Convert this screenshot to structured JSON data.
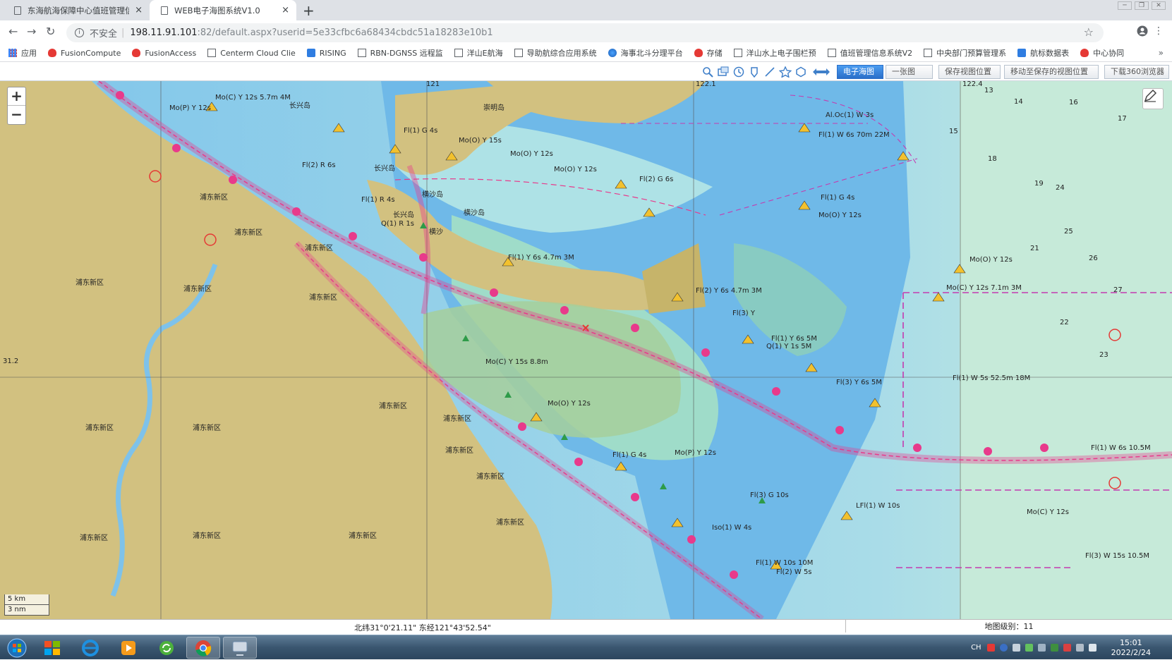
{
  "tabs": [
    {
      "title": "东海航海保障中心值班管理信息系统",
      "close": "×"
    },
    {
      "title": "WEB电子海图系统V1.0",
      "close": "×"
    }
  ],
  "newtab": "+",
  "window_controls": [
    "─",
    "❐",
    "✕"
  ],
  "omnibox": {
    "insecure_label": "不安全",
    "separator": "|",
    "host": "198.11.91.101",
    "rest": ":82/default.aspx?userid=5e33cfbc6a68434cbdc51a18283e10b1"
  },
  "nav": {
    "back": "←",
    "forward": "→",
    "reload": "↻",
    "info": "i",
    "star": "☆",
    "menu": "⋮"
  },
  "bookmarks": [
    {
      "label": "应用",
      "icon": "apps-grid-icon"
    },
    {
      "label": "FusionCompute",
      "icon": "huawei-icon"
    },
    {
      "label": "FusionAccess",
      "icon": "huawei-icon"
    },
    {
      "label": "Centerm Cloud Clie",
      "icon": "page-icon"
    },
    {
      "label": "RISING",
      "icon": "rising-icon"
    },
    {
      "label": "RBN-DGNSS 远程监",
      "icon": "page-icon"
    },
    {
      "label": "洋山E航海",
      "icon": "page-icon"
    },
    {
      "label": "导助航综合应用系统",
      "icon": "page-icon"
    },
    {
      "label": "海事北斗分理平台",
      "icon": "globe-icon"
    },
    {
      "label": "存储",
      "icon": "huawei-icon"
    },
    {
      "label": "洋山水上电子围栏预",
      "icon": "page-icon"
    },
    {
      "label": "值班管理信息系统V2",
      "icon": "page-icon"
    },
    {
      "label": "中央部门预算管理系",
      "icon": "page-icon"
    },
    {
      "label": "航标数据表",
      "icon": "pen-icon"
    },
    {
      "label": "中心协同",
      "icon": "swirl-icon"
    }
  ],
  "bookmarks_more": "»",
  "toolbar": {
    "tools": [
      "zoom-in-tool-icon",
      "pan-tool-icon",
      "clock-tool-icon",
      "marker-tool-icon",
      "line-tool-icon",
      "polygon-tool-icon",
      "circle-tool-icon",
      "measure-tool-icon"
    ],
    "buttons": [
      {
        "label": "电子海图",
        "active": true
      },
      {
        "label": "一张图",
        "active": false
      },
      {
        "label": "保存视图位置",
        "active": false
      },
      {
        "label": "移动至保存的视图位置",
        "active": false
      },
      {
        "label": "下载360浏览器",
        "active": false
      }
    ]
  },
  "map": {
    "zoom_in": "+",
    "zoom_out": "−",
    "scale_km": "5 km",
    "scale_nm": "3 nm",
    "grid_labels": {
      "lon1": "121",
      "lon2": "122.1",
      "lon3": "122.4",
      "lat1": "31.2"
    },
    "place_labels": [
      "浦东新区",
      "浦东新区",
      "浦东新区",
      "浦东新区",
      "浦东新区",
      "浦东新区",
      "浦东新区",
      "浦东新区",
      "浦东新区",
      "浦东新区",
      "浦东新区",
      "浦东新区",
      "浦东新区",
      "浦东新区",
      "浦东新区",
      "浦东新区",
      "崇明岛",
      "长兴岛",
      "长兴岛",
      "横沙岛",
      "横沙岛",
      "横沙",
      "长兴岛"
    ],
    "light_labels": [
      "Mo(C) Y 12s 5.7m 4M",
      "Mo(P) Y 12s",
      "Fl(2) R 6s",
      "Fl(1) R 4s",
      "Q(1) R 1s",
      "Fl(1) G 4s",
      "Mo(O) Y 15s",
      "Mo(O) Y 12s",
      "Fl(2) G 6s",
      "Mo(O) Y 12s",
      "Fl(1) Y 6s 4.7m 3M",
      "Fl(2) Y 6s 4.7m 3M",
      "Fl(3) Y",
      "Fl(1) Y 6s 5M",
      "Q(1) Y 1s 5M",
      "Mo(C) Y 15s 8.8m",
      "Fl(3) Y 6s 5M",
      "Fl(1) W 5s 52.5m 18M",
      "Fl(1) W 6s 10.5M",
      "Mo(P) Y 12s",
      "Mo(O) Y 12s",
      "Fl(1) G 4s",
      "Fl(3) G 10s",
      "LFl(1) W 10s",
      "Mo(C) Y 12s",
      "Fl(3) W 15s 10.5M",
      "Fl(1) W 10s 10M",
      "Fl(2) W 5s",
      "Iso(1) W 4s",
      "Mo(O) Y 12s",
      "Mo(C) Y 12s 7.1m 3M",
      "Al.Oc(1) W 3s",
      "Fl(1) W 6s 70m 22M",
      "Fl(1) G 4s",
      "Mo(O) Y 12s"
    ],
    "depth_labels": [
      "13",
      "16",
      "17",
      "15",
      "18",
      "25",
      "26",
      "27",
      "22",
      "23",
      "24",
      "21",
      "14",
      "19"
    ]
  },
  "status": {
    "coords": "北纬31°0'21.11\" 东经121°43'52.54\"",
    "zoom_level": "地图级别：11"
  },
  "taskbar": {
    "apps": [
      "start-orb-icon",
      "windows-explorer-icon",
      "ie-browser-icon",
      "media-player-icon",
      "sync-app-icon",
      "chrome-icon",
      "remote-app-icon"
    ],
    "tray_lang": "CH",
    "clock_time": "15:01",
    "clock_date": "2022/2/24"
  },
  "colors": {
    "land": "#d2c180",
    "shallow": "#9fdfe6",
    "deep": "#7cc3ec",
    "channel_magenta": "#e83a8b",
    "active_button": "#2a6fc9",
    "taskbar": "#3a5670"
  }
}
